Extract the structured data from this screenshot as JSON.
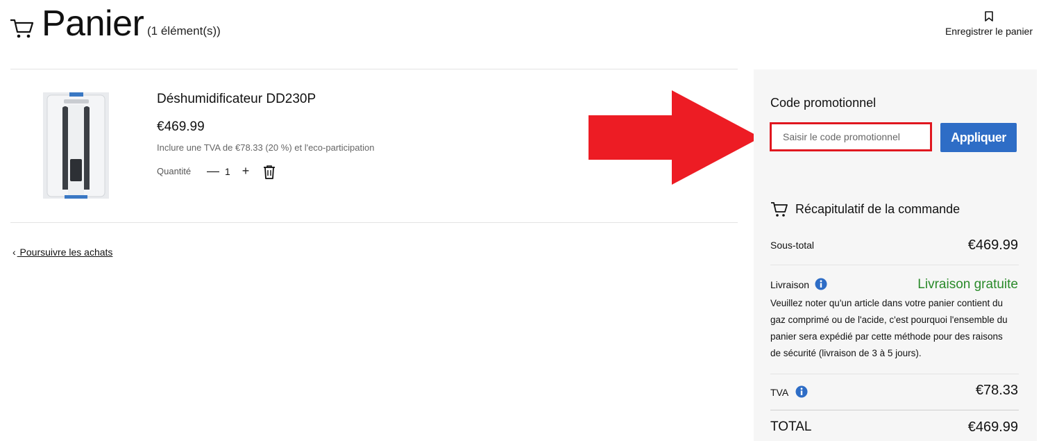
{
  "header": {
    "title": "Panier",
    "item_count": "(1 élément(s))",
    "save_cart_label": "Enregistrer le panier"
  },
  "item": {
    "name": "Déshumidificateur DD230P",
    "price": "€469.99",
    "tax_note": "Inclure une TVA de €78.33 (20 %) et l'eco-participation",
    "quantity_label": "Quantité",
    "quantity": "1",
    "minus_symbol": "—",
    "plus_symbol": "+"
  },
  "continue_shopping": {
    "chevron": "‹",
    "label": " Poursuivre les achats"
  },
  "promo": {
    "title": "Code promotionnel",
    "placeholder": "Saisir le code promotionnel",
    "apply_label": "Appliquer"
  },
  "summary": {
    "title": "Récapitulatif de la commande",
    "subtotal_label": "Sous-total",
    "subtotal_value": "€469.99",
    "shipping_label": "Livraison",
    "shipping_value": "Livraison gratuite",
    "shipping_note": "Veuillez noter qu'un article dans votre panier contient du gaz comprimé ou de l'acide, c'est pourquoi l'ensemble du panier sera expédié par cette méthode pour des raisons de sécurité (livraison de 3 à 5 jours).",
    "tva_label": "TVA",
    "tva_value": "€78.33",
    "total_label": "TOTAL",
    "total_value": "€469.99"
  },
  "colors": {
    "accent_blue": "#2e6dc6",
    "highlight_red": "#e0171f",
    "free_shipping_green": "#2a8a2a"
  },
  "icons": [
    "cart-icon",
    "bookmark-icon",
    "trash-icon",
    "chevron-left-icon",
    "info-icon",
    "arrow-right-icon"
  ]
}
